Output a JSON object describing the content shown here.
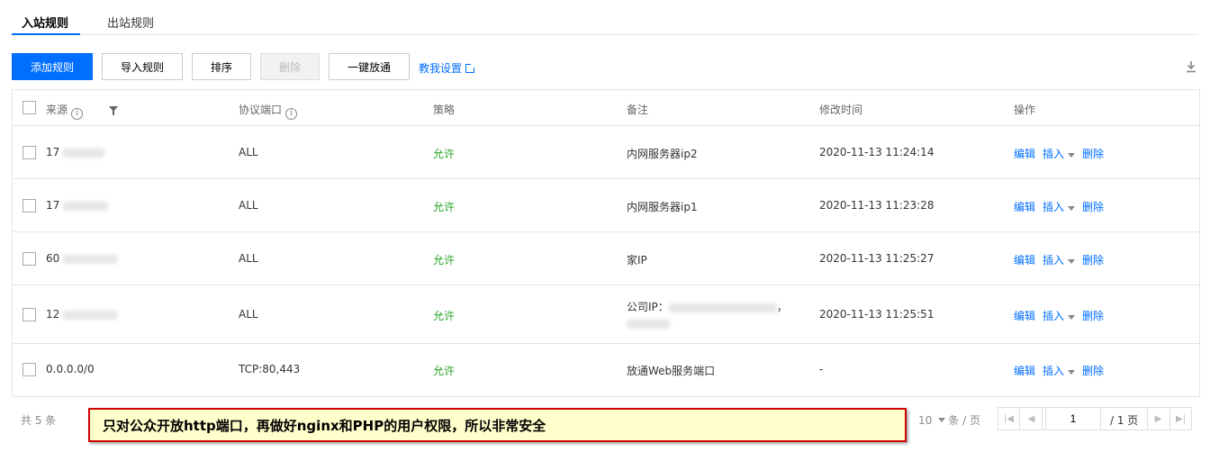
{
  "tabs": [
    {
      "label": "入站规则",
      "active": true
    },
    {
      "label": "出站规则",
      "active": false
    }
  ],
  "toolbar": {
    "add": "添加规则",
    "import": "导入规则",
    "sort": "排序",
    "delete": "删除",
    "allow_all": "一键放通",
    "help": "教我设置"
  },
  "table": {
    "headers": {
      "source": "来源",
      "protocol_port": "协议端口",
      "policy": "策略",
      "remark": "备注",
      "modified": "修改时间",
      "actions": "操作"
    },
    "rows": [
      {
        "source": "17",
        "protocol": "ALL",
        "policy": "允许",
        "remark": "内网服务器ip2",
        "remark2": "",
        "time": "2020-11-13 11:24:14"
      },
      {
        "source": "17",
        "protocol": "ALL",
        "policy": "允许",
        "remark": "内网服务器ip1",
        "remark2": "",
        "time": "2020-11-13 11:23:28"
      },
      {
        "source": "60",
        "protocol": "ALL",
        "policy": "允许",
        "remark": "家IP",
        "remark2": "",
        "time": "2020-11-13 11:25:27"
      },
      {
        "source": "12",
        "protocol": "ALL",
        "policy": "允许",
        "remark": "公司IP：",
        "remark2": "，",
        "time": "2020-11-13 11:25:51"
      },
      {
        "source": "0.0.0.0/0",
        "protocol": "TCP:80,443",
        "policy": "允许",
        "remark": "放通Web服务端口",
        "remark2": "",
        "time": "-"
      }
    ],
    "actions": {
      "edit": "编辑",
      "insert": "插入",
      "delete": "删除"
    }
  },
  "footer": {
    "total": "共 5 条",
    "page_size": "10",
    "page_size_unit": "条 / 页",
    "current_page": "1",
    "total_pages": "/ 1 页"
  },
  "annotation": "只对公众开放http端口，再做好nginx和PHP的用户权限，所以非常安全",
  "colors": {
    "primary": "#006eff",
    "allow": "#29a329",
    "annotation_bg": "#ffffcc",
    "annotation_border": "#cc0000"
  }
}
